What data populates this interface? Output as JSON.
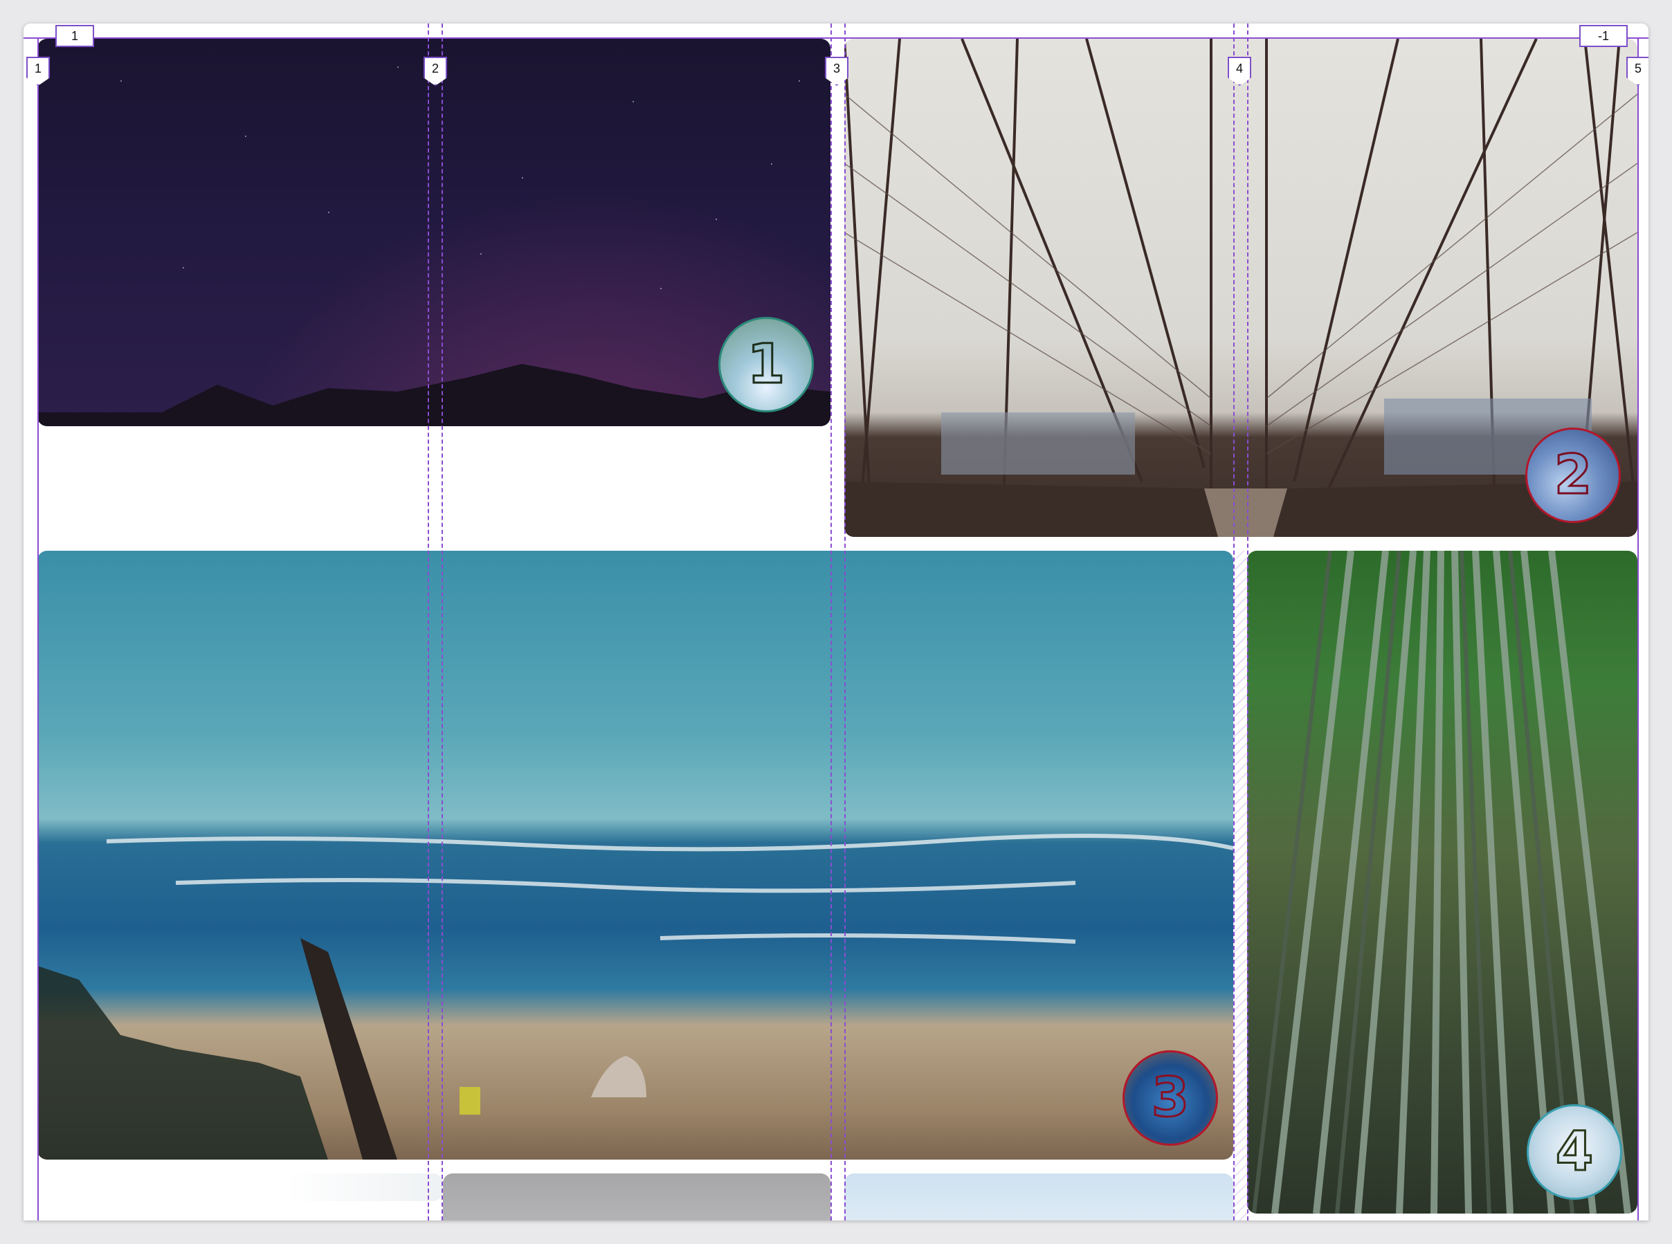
{
  "grid_overlay": {
    "column_labels": [
      "1",
      "2",
      "3",
      "4",
      "5"
    ],
    "row_labels": [
      "1",
      "-1"
    ],
    "line_color": "#8a4cd1"
  },
  "gallery": {
    "items": [
      {
        "name": "night-sky-photo",
        "badge": "1",
        "badge_border": "#2b8a7a"
      },
      {
        "name": "brooklyn-bridge-photo",
        "badge": "2",
        "badge_border": "#b3172a"
      },
      {
        "name": "beach-photo",
        "badge": "3",
        "badge_border": "#b3172a"
      },
      {
        "name": "bamboo-forest-photo",
        "badge": "4",
        "badge_border": "#3a9fb0"
      }
    ]
  }
}
